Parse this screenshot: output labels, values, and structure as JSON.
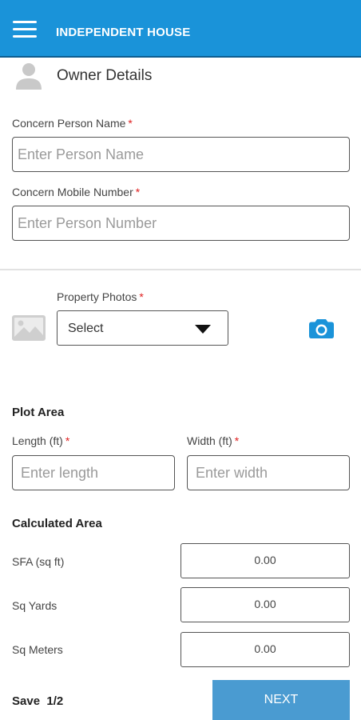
{
  "appbar": {
    "title": "INDEPENDENT HOUSE",
    "color": "#1a93d9"
  },
  "owner": {
    "section_title": "Owner Details",
    "person_name_label": "Concern Person Name",
    "person_name_placeholder": "Enter Person Name",
    "mobile_label": "Concern Mobile Number",
    "mobile_placeholder": "Enter Person Number",
    "required_mark": "*"
  },
  "photos": {
    "label": "Property Photos",
    "select_value": "Select"
  },
  "plot_area": {
    "title": "Plot Area",
    "length_label": "Length (ft)",
    "length_placeholder": "Enter length",
    "width_label": "Width (ft)",
    "width_placeholder": "Enter width"
  },
  "calculated": {
    "title": "Calculated Area",
    "rows": [
      {
        "label": "SFA (sq ft)",
        "value": "0.00"
      },
      {
        "label": "Sq Yards",
        "value": "0.00"
      },
      {
        "label": "Sq Meters",
        "value": "0.00"
      }
    ]
  },
  "footer": {
    "save_label": "Save",
    "page": "1/2",
    "next_label": "NEXT",
    "next_color": "#4a9bd1"
  },
  "icons": {
    "menu": "hamburger-menu-icon",
    "owner": "person-icon",
    "gallery": "image-placeholder-icon",
    "camera": "camera-icon",
    "dropdown": "triangle-down-icon"
  }
}
